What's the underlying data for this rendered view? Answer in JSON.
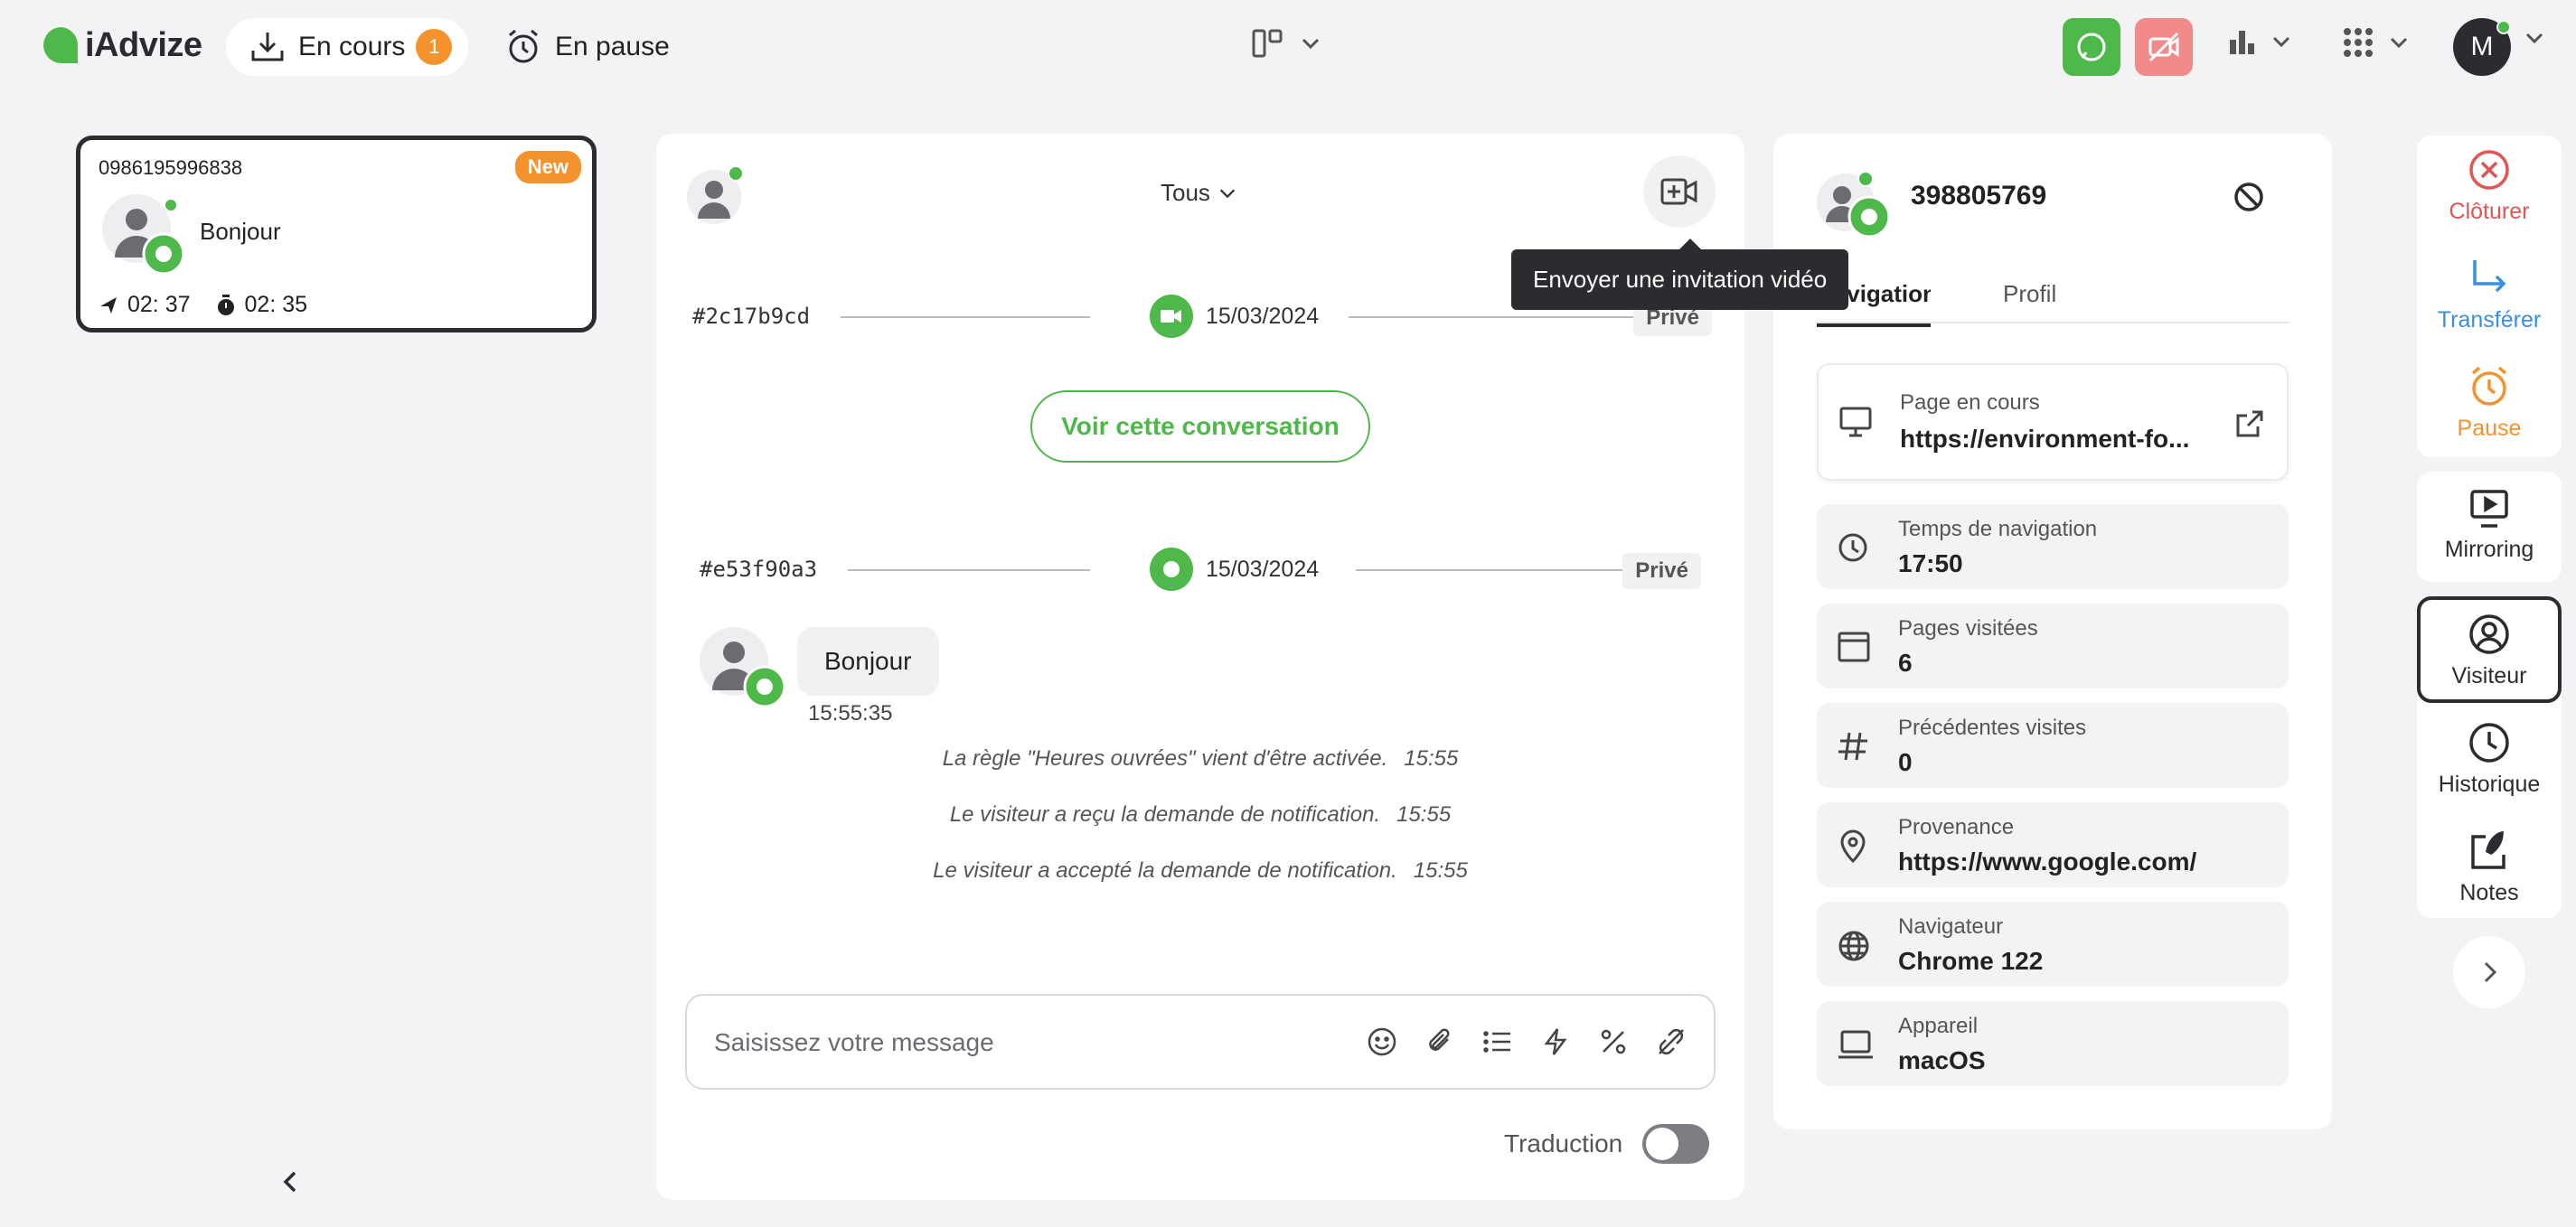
{
  "brand": {
    "name": "iAdvize"
  },
  "header": {
    "tab_en_cours": "En cours",
    "en_cours_count": "1",
    "tab_en_pause": "En pause",
    "user_initial": "M"
  },
  "conversation_card": {
    "phone": "0986195996838",
    "badge": "New",
    "last_message": "Bonjour",
    "sent_time": "02: 37",
    "wait_time": "02: 35"
  },
  "chat": {
    "filter": "Tous",
    "tooltip": "Envoyer une invitation vidéo",
    "separators": [
      {
        "id": "#2c17b9cd",
        "date": "15/03/2024",
        "channel": "video",
        "privacy": "Privé"
      },
      {
        "id": "#e53f90a3",
        "date": "15/03/2024",
        "channel": "chat",
        "privacy": "Privé"
      }
    ],
    "view_conversation_label": "Voir cette conversation",
    "message": {
      "text": "Bonjour",
      "time": "15:55:35"
    },
    "system_events": [
      {
        "text": "La règle \"Heures ouvrées\" vient d'être activée.",
        "time": "15:55"
      },
      {
        "text": "Le visiteur a reçu la demande de notification.",
        "time": "15:55"
      },
      {
        "text": "Le visiteur a accepté la demande de notification.",
        "time": "15:55"
      }
    ],
    "composer_placeholder": "Saisissez votre message",
    "translation_label": "Traduction",
    "translation_enabled": false
  },
  "visitor": {
    "id": "398805769",
    "tabs": [
      {
        "label": "Navigation",
        "active": true
      },
      {
        "label": "Profil",
        "active": false
      }
    ],
    "info": [
      {
        "icon": "monitor-icon",
        "label": "Page en cours",
        "value": "https://environment-fo..."
      },
      {
        "icon": "clock-icon",
        "label": "Temps de navigation",
        "value": "17:50"
      },
      {
        "icon": "browser-window-icon",
        "label": "Pages visitées",
        "value": "6"
      },
      {
        "icon": "hash-icon",
        "label": "Précédentes visites",
        "value": "0"
      },
      {
        "icon": "location-pin-icon",
        "label": "Provenance",
        "value": "https://www.google.com/"
      },
      {
        "icon": "globe-icon",
        "label": "Navigateur",
        "value": "Chrome 122"
      },
      {
        "icon": "laptop-icon",
        "label": "Appareil",
        "value": "macOS"
      }
    ]
  },
  "actions": {
    "close": "Clôturer",
    "transfer": "Transférer",
    "pause": "Pause",
    "mirroring": "Mirroring",
    "visitor": "Visiteur",
    "history": "Historique",
    "notes": "Notes"
  },
  "colors": {
    "accent_green": "#4fb84a",
    "accent_orange": "#f4922d",
    "close_red": "#e05555",
    "transfer_blue": "#3b8fe0",
    "dark": "#2b2b30"
  }
}
